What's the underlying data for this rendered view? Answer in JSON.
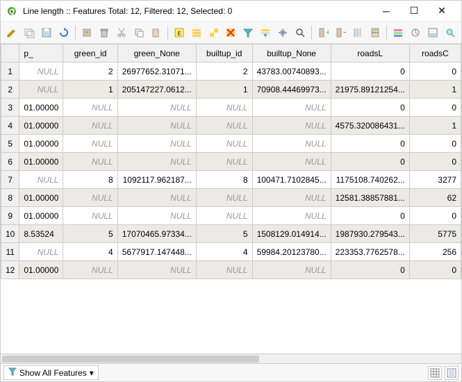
{
  "window": {
    "title": "Line length :: Features Total: 12, Filtered: 12, Selected: 0"
  },
  "columns": [
    "p_",
    "green_id",
    "green_None",
    "builtup_id",
    "builtup_None",
    "roadsL",
    "roadsC"
  ],
  "chart_data": {
    "type": "table",
    "columns": [
      "p_",
      "green_id",
      "green_None",
      "builtup_id",
      "builtup_None",
      "roadsL",
      "roadsC"
    ],
    "rows": [
      {
        "n": 1,
        "p_": null,
        "green_id": "2",
        "green_None": "26977652.31071...",
        "builtup_id": "2",
        "builtup_None": "43783.00740893...",
        "roadsL": "0",
        "roadsC": "0"
      },
      {
        "n": 2,
        "p_": null,
        "green_id": "1",
        "green_None": "205147227.0612...",
        "builtup_id": "1",
        "builtup_None": "70908.44469973...",
        "roadsL": "21975.89121254...",
        "roadsC": "1"
      },
      {
        "n": 3,
        "p_": "01.00000",
        "green_id": null,
        "green_None": null,
        "builtup_id": null,
        "builtup_None": null,
        "roadsL": "0",
        "roadsC": "0"
      },
      {
        "n": 4,
        "p_": "01.00000",
        "green_id": null,
        "green_None": null,
        "builtup_id": null,
        "builtup_None": null,
        "roadsL": "4575.320086431...",
        "roadsC": "1"
      },
      {
        "n": 5,
        "p_": "01.00000",
        "green_id": null,
        "green_None": null,
        "builtup_id": null,
        "builtup_None": null,
        "roadsL": "0",
        "roadsC": "0"
      },
      {
        "n": 6,
        "p_": "01.00000",
        "green_id": null,
        "green_None": null,
        "builtup_id": null,
        "builtup_None": null,
        "roadsL": "0",
        "roadsC": "0"
      },
      {
        "n": 7,
        "p_": null,
        "green_id": "8",
        "green_None": "1092117.962187...",
        "builtup_id": "8",
        "builtup_None": "100471.7102845...",
        "roadsL": "1175108.740262...",
        "roadsC": "3277"
      },
      {
        "n": 8,
        "p_": "01.00000",
        "green_id": null,
        "green_None": null,
        "builtup_id": null,
        "builtup_None": null,
        "roadsL": "12581.38857881...",
        "roadsC": "62"
      },
      {
        "n": 9,
        "p_": "01.00000",
        "green_id": null,
        "green_None": null,
        "builtup_id": null,
        "builtup_None": null,
        "roadsL": "0",
        "roadsC": "0"
      },
      {
        "n": 10,
        "p_": "8.53524",
        "green_id": "5",
        "green_None": "17070465.97334...",
        "builtup_id": "5",
        "builtup_None": "1508129.014914...",
        "roadsL": "1987930.279543...",
        "roadsC": "5775"
      },
      {
        "n": 11,
        "p_": null,
        "green_id": "4",
        "green_None": "5677917.147448...",
        "builtup_id": "4",
        "builtup_None": "59984.20123780...",
        "roadsL": "223353.7762578...",
        "roadsC": "256"
      },
      {
        "n": 12,
        "p_": "01.00000",
        "green_id": null,
        "green_None": null,
        "builtup_id": null,
        "builtup_None": null,
        "roadsL": "0",
        "roadsC": "0"
      }
    ]
  },
  "footer": {
    "filter_label": "Show All Features"
  },
  "null_text": "NULL"
}
